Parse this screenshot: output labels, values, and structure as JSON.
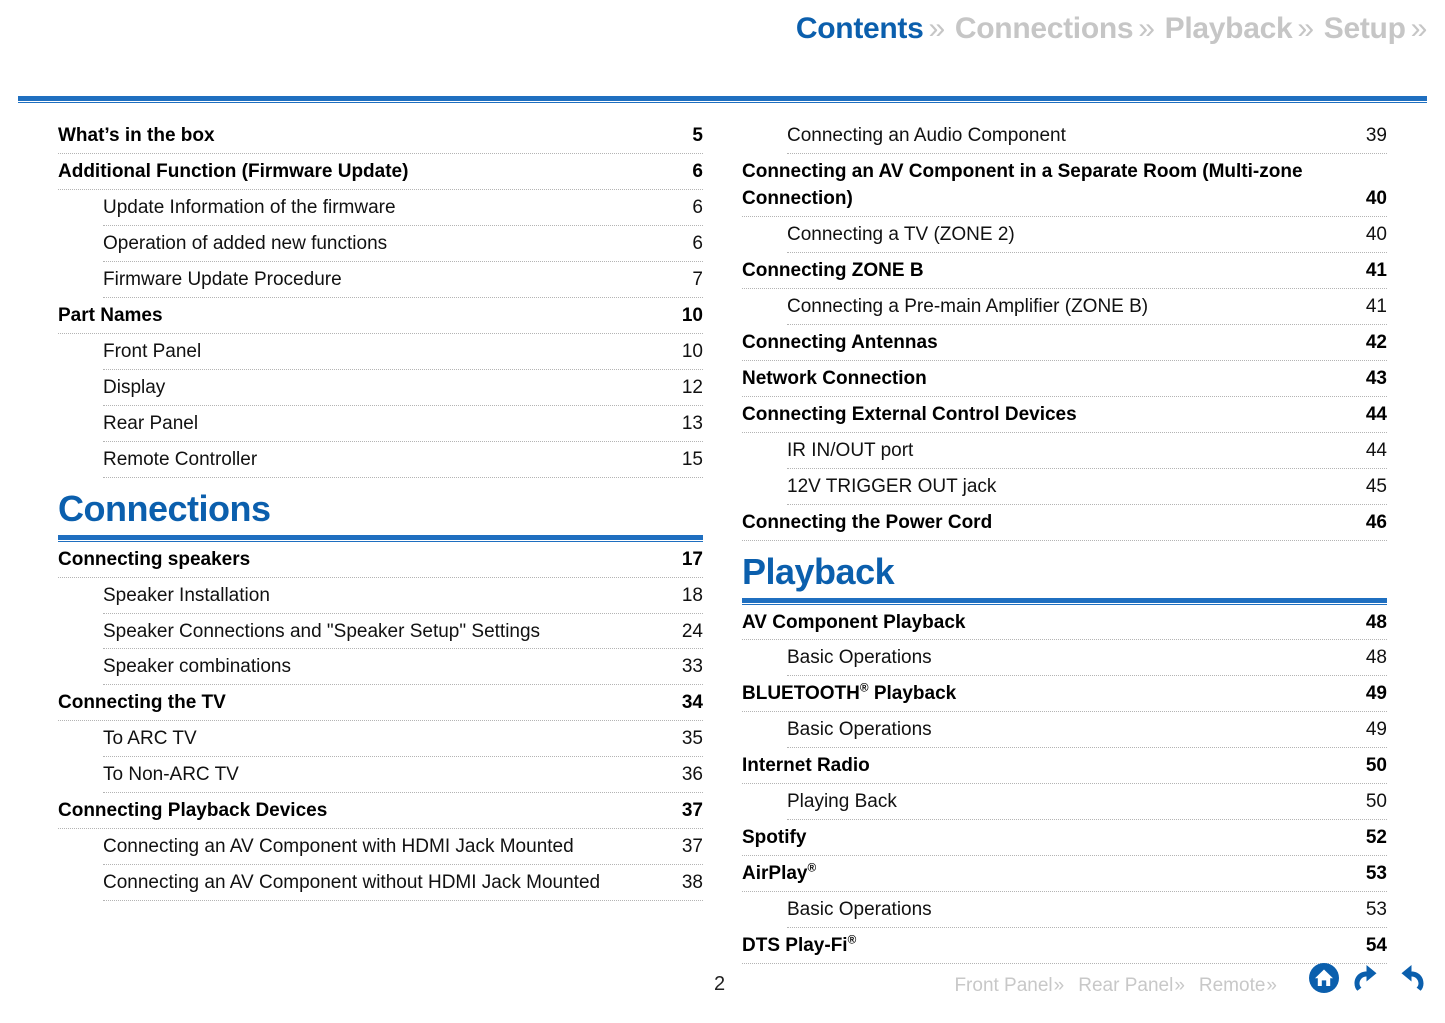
{
  "top_nav": [
    {
      "label": "Contents",
      "state": "active",
      "chevron": "»"
    },
    {
      "label": "Connections",
      "state": "inactive",
      "chevron": "»"
    },
    {
      "label": "Playback",
      "state": "inactive",
      "chevron": "»"
    },
    {
      "label": "Setup",
      "state": "inactive",
      "chevron": "»"
    }
  ],
  "colors": {
    "accent_blue": "#0b5fad",
    "rule_blue": "#1f6fc0",
    "inactive_gray": "#c6c6c6",
    "footer_gray": "#c8c8c8",
    "leader_gray": "#b4b4b4"
  },
  "left_column": [
    {
      "type": "entry",
      "level": 1,
      "title": "What’s in the box",
      "page": "5"
    },
    {
      "type": "entry",
      "level": 1,
      "title": "Additional Function (Firmware Update)",
      "page": "6"
    },
    {
      "type": "entry",
      "level": 2,
      "title": "Update Information of the firmware",
      "page": "6"
    },
    {
      "type": "entry",
      "level": 2,
      "title": "Operation of added new functions",
      "page": "6"
    },
    {
      "type": "entry",
      "level": 2,
      "title": "Firmware Update Procedure",
      "page": "7"
    },
    {
      "type": "entry",
      "level": 1,
      "title": "Part Names",
      "page": "10"
    },
    {
      "type": "entry",
      "level": 2,
      "title": "Front Panel",
      "page": "10"
    },
    {
      "type": "entry",
      "level": 2,
      "title": "Display",
      "page": "12"
    },
    {
      "type": "entry",
      "level": 2,
      "title": "Rear Panel",
      "page": "13"
    },
    {
      "type": "entry",
      "level": 2,
      "title": "Remote Controller",
      "page": "15"
    },
    {
      "type": "section",
      "title": "Connections"
    },
    {
      "type": "entry",
      "level": 1,
      "title": "Connecting speakers",
      "page": "17"
    },
    {
      "type": "entry",
      "level": 2,
      "title": "Speaker Installation",
      "page": "18"
    },
    {
      "type": "entry",
      "level": 2,
      "title": "Speaker Connections and \"Speaker Setup\" Settings",
      "page": "24"
    },
    {
      "type": "entry",
      "level": 2,
      "title": "Speaker combinations",
      "page": "33"
    },
    {
      "type": "entry",
      "level": 1,
      "title": "Connecting the TV",
      "page": "34"
    },
    {
      "type": "entry",
      "level": 2,
      "title": "To ARC TV",
      "page": "35"
    },
    {
      "type": "entry",
      "level": 2,
      "title": "To Non-ARC TV",
      "page": "36"
    },
    {
      "type": "entry",
      "level": 1,
      "title": "Connecting Playback Devices",
      "page": "37"
    },
    {
      "type": "entry",
      "level": 2,
      "title": "Connecting an AV Component with HDMI Jack Mounted",
      "page": "37"
    },
    {
      "type": "entry",
      "level": 2,
      "title": "Connecting an AV Component without HDMI Jack Mounted",
      "page": "38"
    }
  ],
  "right_column": [
    {
      "type": "entry",
      "level": 2,
      "title": "Connecting an Audio Component",
      "page": "39"
    },
    {
      "type": "entry",
      "level": 1,
      "title": "Connecting an AV Component in a Separate Room (Multi-zone Connection)",
      "page": "40"
    },
    {
      "type": "entry",
      "level": 2,
      "title": "Connecting a TV (ZONE 2)",
      "page": "40"
    },
    {
      "type": "entry",
      "level": 1,
      "title": "Connecting ZONE B",
      "page": "41"
    },
    {
      "type": "entry",
      "level": 2,
      "title": "Connecting a Pre-main Amplifier (ZONE B)",
      "page": "41"
    },
    {
      "type": "entry",
      "level": 1,
      "title": "Connecting Antennas",
      "page": "42"
    },
    {
      "type": "entry",
      "level": 1,
      "title": "Network Connection",
      "page": "43"
    },
    {
      "type": "entry",
      "level": 1,
      "title": "Connecting External Control Devices",
      "page": "44"
    },
    {
      "type": "entry",
      "level": 2,
      "title": "IR IN/OUT port",
      "page": "44"
    },
    {
      "type": "entry",
      "level": 2,
      "title": "12V TRIGGER OUT jack",
      "page": "45"
    },
    {
      "type": "entry",
      "level": 1,
      "title": "Connecting the Power Cord",
      "page": "46"
    },
    {
      "type": "section",
      "title": "Playback"
    },
    {
      "type": "entry",
      "level": 1,
      "title": "AV Component Playback",
      "page": "48"
    },
    {
      "type": "entry",
      "level": 2,
      "title": "Basic Operations",
      "page": "48"
    },
    {
      "type": "entry",
      "level": 1,
      "title": "BLUETOOTH",
      "suffix": "®",
      "title_tail": " Playback",
      "page": "49"
    },
    {
      "type": "entry",
      "level": 2,
      "title": "Basic Operations",
      "page": "49"
    },
    {
      "type": "entry",
      "level": 1,
      "title": "Internet Radio",
      "page": "50"
    },
    {
      "type": "entry",
      "level": 2,
      "title": "Playing Back",
      "page": "50"
    },
    {
      "type": "entry",
      "level": 1,
      "title": "Spotify",
      "page": "52"
    },
    {
      "type": "entry",
      "level": 1,
      "title": "AirPlay",
      "suffix": "®",
      "title_tail": "",
      "page": "53"
    },
    {
      "type": "entry",
      "level": 2,
      "title": "Basic Operations",
      "page": "53"
    },
    {
      "type": "entry",
      "level": 1,
      "title": "DTS Play-Fi",
      "suffix": "®",
      "title_tail": "",
      "page": "54"
    }
  ],
  "footer": {
    "page_number": "2",
    "nav": [
      {
        "label": "Front Panel",
        "chevron": "»"
      },
      {
        "label": "Rear Panel",
        "chevron": "»"
      },
      {
        "label": "Remote",
        "chevron": "»"
      }
    ],
    "icons": [
      {
        "name": "home-icon",
        "title": "Home"
      },
      {
        "name": "back-icon",
        "title": "Back"
      },
      {
        "name": "forward-icon",
        "title": "Forward"
      }
    ]
  }
}
